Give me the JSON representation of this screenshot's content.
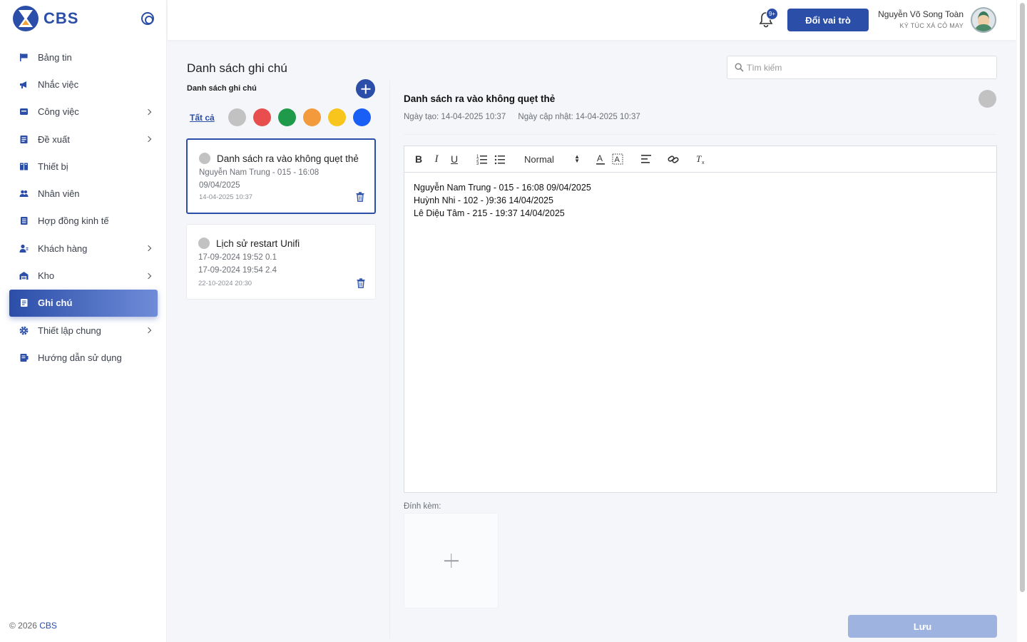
{
  "app": {
    "logo_text": "CBS"
  },
  "sidebar": {
    "items": [
      {
        "label": "Bảng tin",
        "icon": "flag-icon",
        "has_children": false
      },
      {
        "label": "Nhắc việc",
        "icon": "megaphone-icon",
        "has_children": false
      },
      {
        "label": "Công việc",
        "icon": "inbox-icon",
        "has_children": true
      },
      {
        "label": "Đề xuất",
        "icon": "document-icon",
        "has_children": true
      },
      {
        "label": "Thiết bị",
        "icon": "device-icon",
        "has_children": false
      },
      {
        "label": "Nhân viên",
        "icon": "users-icon",
        "has_children": false
      },
      {
        "label": "Hợp đồng kinh tế",
        "icon": "contract-icon",
        "has_children": false
      },
      {
        "label": "Khách hàng",
        "icon": "customer-icon",
        "has_children": true
      },
      {
        "label": "Kho",
        "icon": "warehouse-icon",
        "has_children": true
      },
      {
        "label": "Ghi chú",
        "icon": "note-icon",
        "has_children": false,
        "active": true
      },
      {
        "label": "Thiết lập chung",
        "icon": "gear-icon",
        "has_children": true
      },
      {
        "label": "Hướng dẫn sử dụng",
        "icon": "guide-icon",
        "has_children": false
      }
    ],
    "footer_prefix": "© 2026",
    "footer_brand": "CBS"
  },
  "header": {
    "notification_badge": "9+",
    "role_button": "Đổi vai trò",
    "user_name": "Nguyễn Võ Song Toàn",
    "user_org": "KÝ TÚC XÁ CỎ MAY"
  },
  "notes_panel": {
    "title": "Danh sách ghi chú",
    "list_heading": "Danh sách ghi chú",
    "filter_all": "Tất cả",
    "filter_colors": [
      "#c2c2c2",
      "#e84e4e",
      "#1e9a4a",
      "#f39a3c",
      "#f8c51c",
      "#1a5ff5"
    ],
    "search_placeholder": "Tìm kiếm",
    "notes": [
      {
        "title": "Danh sách ra vào không quẹt thẻ",
        "lines": [
          "Nguyễn Nam Trung - 015 - 16:08",
          "09/04/2025"
        ],
        "date": "14-04-2025 10:37",
        "selected": true
      },
      {
        "title": "Lịch sử restart Unifi",
        "lines": [
          "17-09-2024 19:52 0.1",
          "17-09-2024 19:54 2.4"
        ],
        "date": "22-10-2024 20:30",
        "selected": false
      }
    ]
  },
  "editor": {
    "title": "Danh sách ra vào không quẹt thẻ",
    "created_label": "Ngày tạo: 14-04-2025 10:37",
    "updated_label": "Ngày cập nhật: 14-04-2025 10:37",
    "format_select": "Normal",
    "content_lines": [
      "Nguyễn Nam Trung - 015 - 16:08 09/04/2025",
      "Huỳnh Nhi - 102 - )9:36 14/04/2025",
      "Lê Diệu Tâm - 215 - 19:37 14/04/2025"
    ],
    "attach_label": "Đính kèm:",
    "save_button": "Lưu"
  },
  "colors": {
    "primary": "#2b4ea8",
    "save_disabled": "#9fb3e0"
  }
}
